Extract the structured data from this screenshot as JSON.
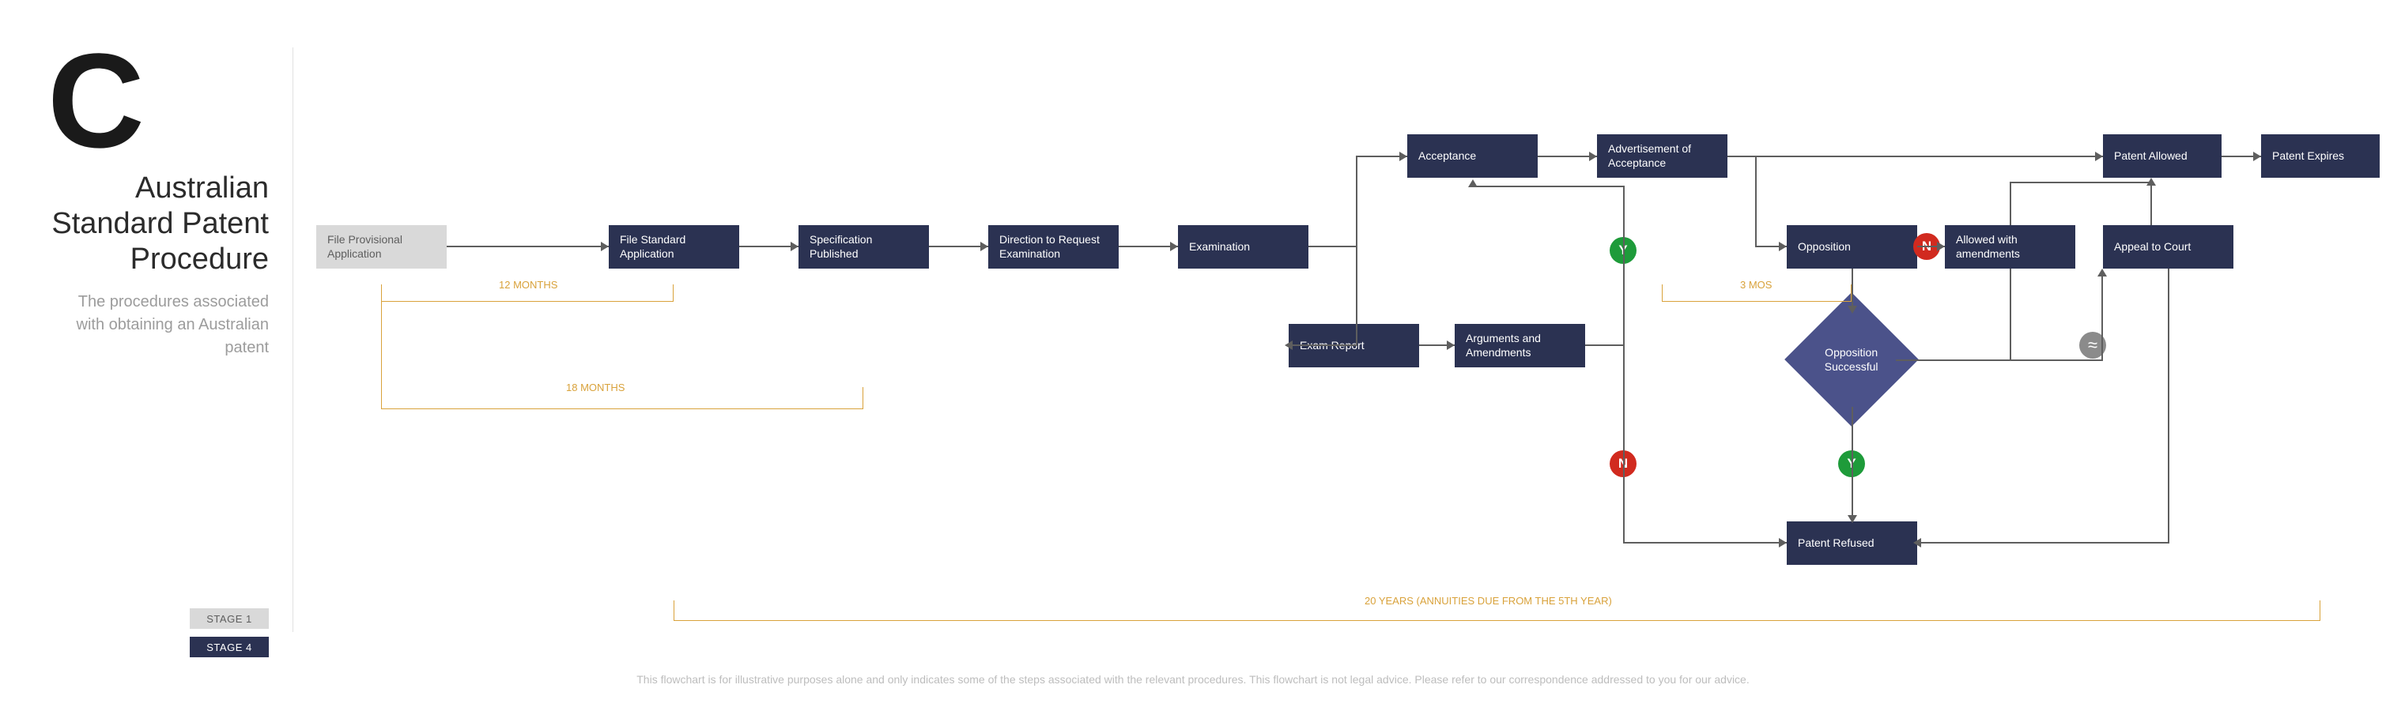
{
  "side": {
    "letter": "C",
    "title": "Australian Standard Patent Procedure",
    "subtitle": "The procedures associated with obtaining an Australian patent"
  },
  "legend": {
    "stage1": "STAGE 1",
    "stage4": "STAGE 4"
  },
  "nodes": {
    "file_prov": "File Provisional Application",
    "file_std": "File Standard Application",
    "spec_pub": "Specification Published",
    "dir_req": "Direction to Request Examination",
    "exam": "Examination",
    "accept": "Acceptance",
    "advert": "Advertisement of Acceptance",
    "exam_report": "Exam Report",
    "args": "Arguments and Amendments",
    "oppo": "Opposition",
    "oppo_succ": "Opposition Successful",
    "allowed_amend": "Allowed with amendments",
    "appeal": "Appeal to Court",
    "patent_allowed": "Patent Allowed",
    "patent_expires": "Patent Expires",
    "patent_refused": "Patent Refused"
  },
  "badges": {
    "y": "Y",
    "n": "N",
    "approx": "≈"
  },
  "spans": {
    "m12": "12 MONTHS",
    "m18": "18 MONTHS",
    "m3": "3 MOS",
    "y20": "20 YEARS (ANNUITIES DUE FROM THE 5TH YEAR)"
  },
  "footer": "This flowchart is for illustrative purposes alone and only indicates some of the steps associated with the relevant procedures. This flowchart is not legal advice. Please refer to our correspondence addressed to you for our advice."
}
